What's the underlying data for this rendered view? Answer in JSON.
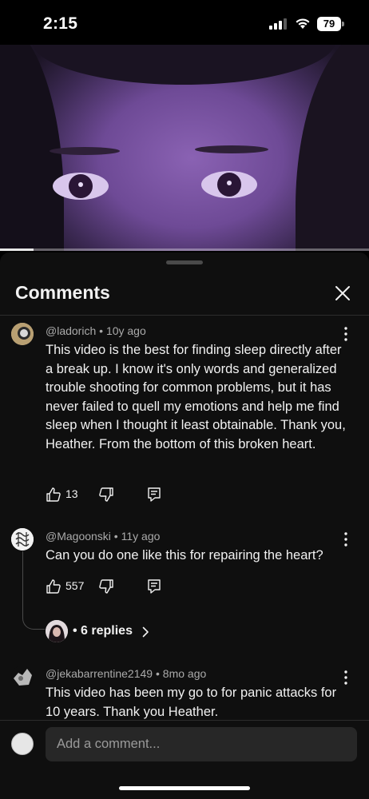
{
  "status_bar": {
    "time": "2:15",
    "battery": "79",
    "icons": [
      "signal-icon",
      "wifi-icon",
      "battery-icon"
    ]
  },
  "video": {
    "progress": 0.09,
    "colors": {
      "tint": "#7a55a6",
      "progress_fill": "#e8e8e8"
    }
  },
  "comments_panel": {
    "title": "Comments",
    "close_icon": "close-icon",
    "comments": [
      {
        "author": "@ladorich",
        "age": "10y ago",
        "text": "This video is the best for finding sleep directly after a break up. I know it's only words and generalized trouble shooting for common problems, but it has never failed to quell my emotions and help me find sleep when I thought it least obtainable. Thank you, Heather. From the bottom of this broken heart.",
        "likes": "13"
      },
      {
        "author": "@Magoonski",
        "age": "11y ago",
        "text": "Can you do one like this for repairing the heart?",
        "likes": "557",
        "replies_label": "• 6 replies"
      },
      {
        "author": "@jekabarrentine2149",
        "age": "8mo ago",
        "text": "This video has been my go to for panic attacks for 10 years. Thank you Heather."
      }
    ],
    "meta_separator": " • "
  },
  "composer": {
    "placeholder": "Add a comment..."
  },
  "colors": {
    "background": "#0f0f0f",
    "text_primary": "#f1f1f1",
    "text_secondary": "#aaaaaa",
    "input_bg": "#272727"
  }
}
